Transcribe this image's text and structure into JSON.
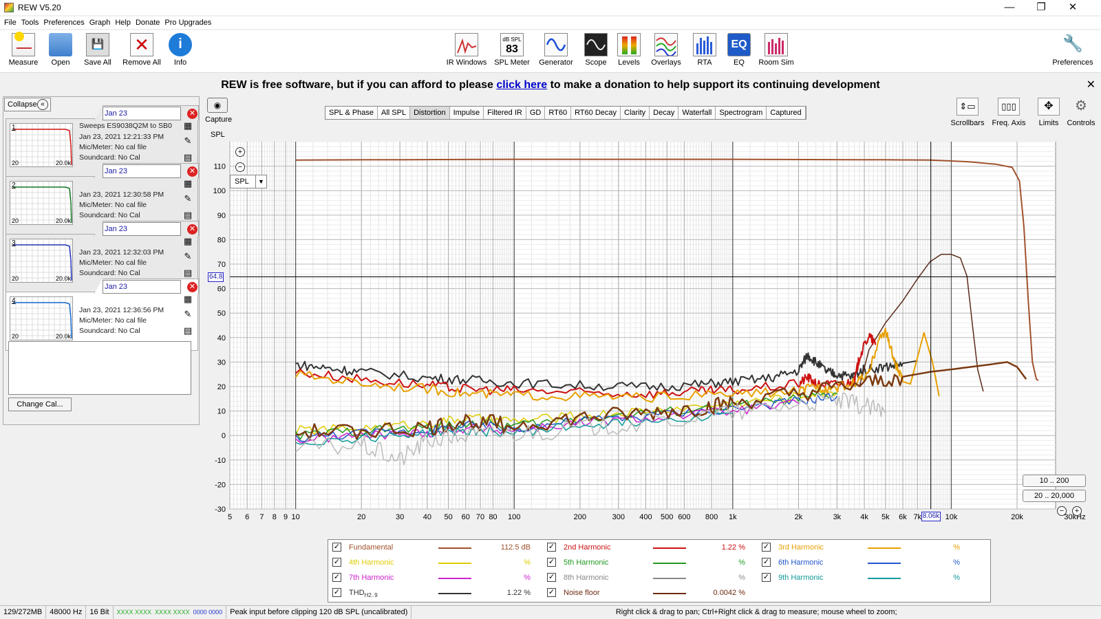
{
  "window": {
    "title": "REW V5.20",
    "min": "—",
    "max": "❐",
    "close": "✕"
  },
  "menu": [
    "File",
    "Tools",
    "Preferences",
    "Graph",
    "Help",
    "Donate",
    "Pro Upgrades"
  ],
  "toolbar_left": [
    {
      "label": "Measure",
      "icon": "measure-icon"
    },
    {
      "label": "Open",
      "icon": "folder-icon"
    },
    {
      "label": "Save All",
      "icon": "save-icon"
    },
    {
      "label": "Remove All",
      "icon": "remove-icon"
    },
    {
      "label": "Info",
      "icon": "info-icon"
    }
  ],
  "toolbar_center": [
    {
      "label": "IR Windows",
      "icon": "ir-windows-icon"
    },
    {
      "label": "SPL Meter",
      "icon": "spl-meter-icon",
      "badge_top": "dB SPL",
      "badge": "83"
    },
    {
      "label": "Generator",
      "icon": "generator-icon"
    },
    {
      "label": "Scope",
      "icon": "scope-icon"
    },
    {
      "label": "Levels",
      "icon": "levels-icon"
    },
    {
      "label": "Overlays",
      "icon": "overlays-icon"
    },
    {
      "label": "RTA",
      "icon": "rta-icon"
    },
    {
      "label": "EQ",
      "icon": "eq-icon"
    },
    {
      "label": "Room Sim",
      "icon": "room-sim-icon"
    }
  ],
  "toolbar_right": {
    "label": "Preferences",
    "icon": "wrench-icon"
  },
  "donate": {
    "pre": "REW is free software, but if you can afford to please ",
    "link": "click here",
    "post": " to make a donation to help support its continuing development",
    "close": "✕"
  },
  "collapse_label": "Collapse",
  "measurements": [
    {
      "num": "1",
      "name": "Jan 23",
      "info": [
        "Sweeps ES9038Q2M to SB0",
        "Jan 23, 2021 12:21:33 PM",
        "Mic/Meter: No cal file",
        "Soundcard: No Cal"
      ],
      "color": "#cc1111",
      "thumb_a": "20",
      "thumb_b": "20.0k"
    },
    {
      "num": "2",
      "name": "Jan 23",
      "info": [
        "",
        "Jan 23, 2021 12:30:58 PM",
        "Mic/Meter: No cal file",
        "Soundcard: No Cal"
      ],
      "color": "#117722",
      "thumb_a": "20",
      "thumb_b": "20.0k"
    },
    {
      "num": "3",
      "name": "Jan 23",
      "info": [
        "",
        "Jan 23, 2021 12:32:03 PM",
        "Mic/Meter: No cal file",
        "Soundcard: No Cal"
      ],
      "color": "#2233bb",
      "thumb_a": "20",
      "thumb_b": "20.0k"
    },
    {
      "num": "4",
      "name": "Jan 23",
      "info": [
        "",
        "Jan 23, 2021 12:36:56 PM",
        "Mic/Meter: No cal file",
        "Soundcard: No Cal"
      ],
      "color": "#1166cc",
      "thumb_a": "20",
      "thumb_b": "20.0k"
    }
  ],
  "change_cal": "Change Cal...",
  "capture_label": "Capture",
  "graph_tabs": [
    "SPL & Phase",
    "All SPL",
    "Distortion",
    "Impulse",
    "Filtered IR",
    "GD",
    "RT60",
    "RT60 Decay",
    "Clarity",
    "Decay",
    "Waterfall",
    "Spectrogram",
    "Captured"
  ],
  "active_tab": "Distortion",
  "graph_tools": [
    {
      "label": "Scrollbars",
      "icon": "scrollbars-icon"
    },
    {
      "label": "Freq. Axis",
      "icon": "freq-axis-icon"
    },
    {
      "label": "Limits",
      "icon": "limits-icon"
    },
    {
      "label": "Controls",
      "icon": "gear-icon"
    }
  ],
  "spl_select": "SPL",
  "range_buttons": [
    "10 .. 200",
    "20 .. 20,000"
  ],
  "cursor": {
    "y_value": "64.8",
    "x_value": "8.06k"
  },
  "chart_data": {
    "type": "line",
    "ylabel": "SPL",
    "xunit_label": "30kHz",
    "ylim": [
      -30,
      120
    ],
    "xlim": [
      5,
      30000
    ],
    "log_x": true,
    "grid": true,
    "y_ticks": [
      110,
      100,
      90,
      80,
      70,
      60,
      50,
      40,
      30,
      20,
      10,
      0,
      -10,
      -20,
      -30
    ],
    "x_ticks": [
      {
        "v": 5,
        "t": "5"
      },
      {
        "v": 6,
        "t": "6"
      },
      {
        "v": 7,
        "t": "7"
      },
      {
        "v": 8,
        "t": "8"
      },
      {
        "v": 9,
        "t": "9"
      },
      {
        "v": 10,
        "t": "10"
      },
      {
        "v": 20,
        "t": "20"
      },
      {
        "v": 30,
        "t": "30"
      },
      {
        "v": 40,
        "t": "40"
      },
      {
        "v": 50,
        "t": "50"
      },
      {
        "v": 60,
        "t": "60"
      },
      {
        "v": 70,
        "t": "70"
      },
      {
        "v": 80,
        "t": "80"
      },
      {
        "v": 100,
        "t": "100"
      },
      {
        "v": 200,
        "t": "200"
      },
      {
        "v": 300,
        "t": "300"
      },
      {
        "v": 400,
        "t": "400"
      },
      {
        "v": 500,
        "t": "500"
      },
      {
        "v": 600,
        "t": "600"
      },
      {
        "v": 800,
        "t": "800"
      },
      {
        "v": 1000,
        "t": "1k"
      },
      {
        "v": 2000,
        "t": "2k"
      },
      {
        "v": 3000,
        "t": "3k"
      },
      {
        "v": 4000,
        "t": "4k"
      },
      {
        "v": 5000,
        "t": "5k"
      },
      {
        "v": 6000,
        "t": "6k"
      },
      {
        "v": 7000,
        "t": "7k"
      },
      {
        "v": 10000,
        "t": "10k"
      },
      {
        "v": 20000,
        "t": "20k"
      }
    ],
    "cursor": {
      "x": 8060,
      "y": 64.8
    },
    "series": [
      {
        "key": "fundamental",
        "color": "#a0522d",
        "width": 2,
        "points": [
          [
            10,
            112.5
          ],
          [
            100,
            112.8
          ],
          [
            1000,
            112.8
          ],
          [
            5000,
            112.6
          ],
          [
            8000,
            112.5
          ],
          [
            12000,
            111.8
          ],
          [
            16000,
            110.8
          ],
          [
            19000,
            109.5
          ],
          [
            20500,
            104
          ],
          [
            21500,
            85
          ],
          [
            22500,
            55
          ],
          [
            23500,
            30
          ],
          [
            24500,
            23
          ],
          [
            25000,
            22.5
          ]
        ]
      },
      {
        "key": "thd",
        "color": "#333333",
        "width": 2,
        "points": [
          [
            10,
            29
          ],
          [
            14,
            27.5
          ],
          [
            20,
            26
          ],
          [
            40,
            23.5
          ],
          [
            60,
            22.8
          ],
          [
            100,
            21.5
          ],
          [
            200,
            20.5
          ],
          [
            400,
            19.8
          ],
          [
            700,
            20.8
          ],
          [
            1000,
            22
          ],
          [
            1500,
            23.5
          ],
          [
            2000,
            26.5
          ],
          [
            2200,
            33
          ],
          [
            2400,
            30
          ],
          [
            2700,
            26
          ],
          [
            3000,
            25
          ],
          [
            3500,
            24
          ],
          [
            4000,
            27
          ],
          [
            5000,
            28
          ],
          [
            6000,
            29.5
          ],
          [
            7000,
            30.5
          ]
        ]
      },
      {
        "key": "noise",
        "color": "#5a2a1a",
        "width": 1.5,
        "points": [
          [
            3800,
            20
          ],
          [
            4200,
            35
          ],
          [
            5000,
            46
          ],
          [
            6000,
            55
          ],
          [
            7000,
            64
          ],
          [
            8000,
            71
          ],
          [
            9000,
            74
          ],
          [
            10000,
            74
          ],
          [
            11000,
            72.5
          ],
          [
            11800,
            65
          ],
          [
            12500,
            45
          ],
          [
            13200,
            27
          ],
          [
            14000,
            18
          ]
        ]
      },
      {
        "key": "h2",
        "color": "#cc1111",
        "width": 2,
        "points": [
          [
            10,
            26
          ],
          [
            20,
            23
          ],
          [
            40,
            20.5
          ],
          [
            60,
            19
          ],
          [
            100,
            18.5
          ],
          [
            200,
            17.5
          ],
          [
            400,
            17
          ],
          [
            700,
            18
          ],
          [
            1000,
            18.5
          ],
          [
            2000,
            21
          ],
          [
            2200,
            24
          ],
          [
            2400,
            21
          ],
          [
            3000,
            21
          ],
          [
            3600,
            22
          ],
          [
            3800,
            32
          ],
          [
            4200,
            41
          ],
          [
            4500,
            37
          ]
        ]
      },
      {
        "key": "h3",
        "color": "#e8a000",
        "width": 2,
        "points": [
          [
            10,
            25
          ],
          [
            20,
            21.5
          ],
          [
            40,
            19
          ],
          [
            60,
            17
          ],
          [
            100,
            16.5
          ],
          [
            200,
            16
          ],
          [
            400,
            15.5
          ],
          [
            1000,
            17
          ],
          [
            2000,
            18
          ],
          [
            2400,
            20
          ],
          [
            2700,
            19
          ],
          [
            3500,
            21
          ],
          [
            4200,
            25
          ],
          [
            4600,
            38
          ],
          [
            5000,
            43
          ],
          [
            5500,
            30
          ],
          [
            6000,
            22
          ],
          [
            6500,
            21
          ],
          [
            7500,
            42
          ],
          [
            8200,
            30
          ],
          [
            8800,
            16
          ]
        ]
      },
      {
        "key": "h4",
        "color": "#ddcc00",
        "width": 1.5,
        "points": [
          [
            10,
            2
          ],
          [
            20,
            3
          ],
          [
            40,
            5
          ],
          [
            60,
            7
          ],
          [
            100,
            6
          ],
          [
            200,
            8
          ],
          [
            400,
            10
          ],
          [
            1000,
            13
          ],
          [
            2000,
            16
          ],
          [
            3000,
            18
          ]
        ]
      },
      {
        "key": "h5",
        "color": "#229922",
        "width": 1.5,
        "points": [
          [
            10,
            0
          ],
          [
            20,
            2
          ],
          [
            40,
            3
          ],
          [
            60,
            5
          ],
          [
            100,
            4
          ],
          [
            200,
            7
          ],
          [
            400,
            9
          ],
          [
            1000,
            12
          ],
          [
            2000,
            15
          ],
          [
            3000,
            17
          ]
        ]
      },
      {
        "key": "h6",
        "color": "#2255cc",
        "width": 1.5,
        "points": [
          [
            10,
            -1
          ],
          [
            20,
            1
          ],
          [
            40,
            2
          ],
          [
            60,
            4
          ],
          [
            100,
            3
          ],
          [
            200,
            6
          ],
          [
            400,
            8
          ],
          [
            1000,
            11
          ],
          [
            2000,
            14
          ],
          [
            3000,
            16
          ]
        ]
      },
      {
        "key": "h7",
        "color": "#cc22cc",
        "width": 1.5,
        "points": [
          [
            10,
            -2
          ],
          [
            20,
            0
          ],
          [
            40,
            1
          ],
          [
            60,
            3
          ],
          [
            100,
            2
          ],
          [
            200,
            5
          ],
          [
            400,
            7
          ],
          [
            1000,
            10
          ],
          [
            2000,
            13
          ]
        ]
      },
      {
        "key": "h9",
        "color": "#119999",
        "width": 1.5,
        "points": [
          [
            10,
            -3
          ],
          [
            20,
            -1
          ],
          [
            40,
            1
          ],
          [
            60,
            2
          ],
          [
            100,
            1
          ],
          [
            200,
            4
          ],
          [
            400,
            6
          ],
          [
            1000,
            9
          ]
        ]
      },
      {
        "key": "nf",
        "color": "#7b3a10",
        "width": 2.5,
        "points": [
          [
            10,
            1
          ],
          [
            20,
            2
          ],
          [
            40,
            3
          ],
          [
            60,
            6
          ],
          [
            100,
            4
          ],
          [
            200,
            7
          ],
          [
            400,
            9
          ],
          [
            700,
            11
          ],
          [
            1000,
            13
          ],
          [
            2000,
            17
          ],
          [
            4000,
            21
          ],
          [
            6000,
            24
          ],
          [
            8000,
            26
          ],
          [
            10000,
            27
          ],
          [
            15000,
            29
          ],
          [
            18000,
            30
          ],
          [
            20000,
            28
          ],
          [
            22000,
            23
          ]
        ]
      },
      {
        "key": "h8",
        "color": "#bbbbbb",
        "width": 1.5,
        "points": [
          [
            10,
            -5
          ],
          [
            20,
            -4
          ],
          [
            30,
            -10
          ],
          [
            40,
            -2
          ],
          [
            60,
            0
          ],
          [
            100,
            1
          ],
          [
            200,
            3
          ],
          [
            400,
            5
          ],
          [
            1000,
            9
          ],
          [
            2000,
            13
          ],
          [
            3000,
            14
          ],
          [
            4000,
            12
          ],
          [
            5000,
            9
          ]
        ]
      }
    ]
  },
  "legend": [
    {
      "name": "Fundamental",
      "color": "#a0522d",
      "value": "112.5 dB",
      "col": 0,
      "row": 0
    },
    {
      "name": "2nd Harmonic",
      "color": "#cc1111",
      "value": "1.22 %",
      "col": 1,
      "row": 0
    },
    {
      "name": "3rd Harmonic",
      "color": "#e8a000",
      "value": "%",
      "col": 2,
      "row": 0
    },
    {
      "name": "4th Harmonic",
      "color": "#ddcc00",
      "value": "%",
      "col": 0,
      "row": 1
    },
    {
      "name": "5th Harmonic",
      "color": "#229922",
      "value": "%",
      "col": 1,
      "row": 1
    },
    {
      "name": "6th Harmonic",
      "color": "#2255cc",
      "value": "%",
      "col": 2,
      "row": 1
    },
    {
      "name": "7th Harmonic",
      "color": "#cc22cc",
      "value": "%",
      "col": 0,
      "row": 2
    },
    {
      "name": "8th Harmonic",
      "color": "#888888",
      "value": "%",
      "col": 1,
      "row": 2
    },
    {
      "name": "9th Harmonic",
      "color": "#119999",
      "value": "%",
      "col": 2,
      "row": 2
    },
    {
      "name": "THD",
      "sub": "H2..9",
      "color": "#333333",
      "value": "1.22 %",
      "col": 0,
      "row": 3
    },
    {
      "name": "Noise floor",
      "color": "#6b2a10",
      "value": "0.0042 %",
      "col": 1,
      "row": 3
    }
  ],
  "status": {
    "memory": "129/272MB",
    "rate": "48000 Hz",
    "bits": "16 Bit",
    "in_meter": "XXXX XXXX",
    "out_meter": "XXXX XXXX",
    "counter": "0000 0000",
    "peak": "Peak input before clipping 120 dB SPL (uncalibrated)",
    "hint": "Right click & drag to pan; Ctrl+Right click & drag to measure; mouse wheel to zoom;"
  }
}
